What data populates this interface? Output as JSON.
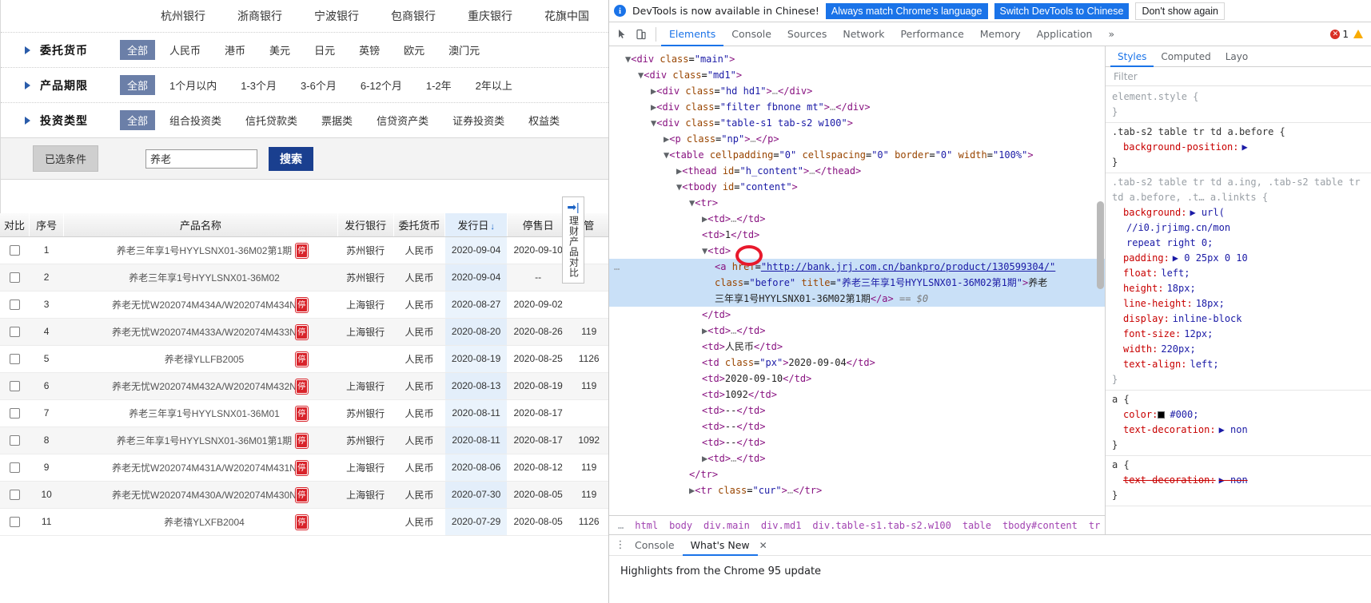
{
  "page": {
    "banks": [
      "杭州银行",
      "浙商银行",
      "宁波银行",
      "包商银行",
      "重庆银行",
      "花旗中国"
    ],
    "filters": [
      {
        "label": "委托货币",
        "all": "全部",
        "options": [
          "人民币",
          "港币",
          "美元",
          "日元",
          "英镑",
          "欧元",
          "澳门元"
        ]
      },
      {
        "label": "产品期限",
        "all": "全部",
        "options": [
          "1个月以内",
          "1-3个月",
          "3-6个月",
          "6-12个月",
          "1-2年",
          "2年以上"
        ]
      },
      {
        "label": "投资类型",
        "all": "全部",
        "options": [
          "组合投资类",
          "信托贷款类",
          "票据类",
          "信贷资产类",
          "证券投资类",
          "权益类"
        ]
      }
    ],
    "search": {
      "selected_conditions_label": "已选条件",
      "input_value": "养老",
      "input_placeholder": "",
      "button_label": "搜索"
    },
    "compare_panel": {
      "arrow": "➡|",
      "text": "理财产品对比"
    },
    "table": {
      "headers": [
        "对比",
        "序号",
        "产品名称",
        "发行银行",
        "委托货币",
        "发行日",
        "停售日",
        "管"
      ],
      "sorted_column": "发行日",
      "sort_arrow": "↓",
      "rows": [
        {
          "no": "1",
          "name": "养老三年享1号HYYLSNX01-36M02第1期",
          "stop": "停",
          "bank": "苏州银行",
          "cur": "人民币",
          "issue": "2020-09-04",
          "stopdate": "2020-09-10",
          "mg": ""
        },
        {
          "no": "2",
          "name": "养老三年享1号HYYLSNX01-36M02",
          "stop": "",
          "bank": "苏州银行",
          "cur": "人民币",
          "issue": "2020-09-04",
          "stopdate": "--",
          "mg": ""
        },
        {
          "no": "3",
          "name": "养老无忧W202074M434A/W202074M434N",
          "stop": "停",
          "bank": "上海银行",
          "cur": "人民币",
          "issue": "2020-08-27",
          "stopdate": "2020-09-02",
          "mg": ""
        },
        {
          "no": "4",
          "name": "养老无忧W202074M433A/W202074M433N",
          "stop": "停",
          "bank": "上海银行",
          "cur": "人民币",
          "issue": "2020-08-20",
          "stopdate": "2020-08-26",
          "mg": "119"
        },
        {
          "no": "5",
          "name": "养老禄YLLFB2005",
          "stop": "停",
          "bank": "",
          "cur": "人民币",
          "issue": "2020-08-19",
          "stopdate": "2020-08-25",
          "mg": "1126"
        },
        {
          "no": "6",
          "name": "养老无忧W202074M432A/W202074M432N",
          "stop": "停",
          "bank": "上海银行",
          "cur": "人民币",
          "issue": "2020-08-13",
          "stopdate": "2020-08-19",
          "mg": "119"
        },
        {
          "no": "7",
          "name": "养老三年享1号HYYLSNX01-36M01",
          "stop": "停",
          "bank": "苏州银行",
          "cur": "人民币",
          "issue": "2020-08-11",
          "stopdate": "2020-08-17",
          "mg": ""
        },
        {
          "no": "8",
          "name": "养老三年享1号HYYLSNX01-36M01第1期",
          "stop": "停",
          "bank": "苏州银行",
          "cur": "人民币",
          "issue": "2020-08-11",
          "stopdate": "2020-08-17",
          "mg": "1092"
        },
        {
          "no": "9",
          "name": "养老无忧W202074M431A/W202074M431N",
          "stop": "停",
          "bank": "上海银行",
          "cur": "人民币",
          "issue": "2020-08-06",
          "stopdate": "2020-08-12",
          "mg": "119"
        },
        {
          "no": "10",
          "name": "养老无忧W202074M430A/W202074M430N",
          "stop": "停",
          "bank": "上海银行",
          "cur": "人民币",
          "issue": "2020-07-30",
          "stopdate": "2020-08-05",
          "mg": "119"
        },
        {
          "no": "11",
          "name": "养老禧YLXFB2004",
          "stop": "停",
          "bank": "",
          "cur": "人民币",
          "issue": "2020-07-29",
          "stopdate": "2020-08-05",
          "mg": "1126"
        }
      ]
    }
  },
  "devtools": {
    "banner": {
      "message": "DevTools is now available in Chinese!",
      "btn_always": "Always match Chrome's language",
      "btn_switch": "Switch DevTools to Chinese",
      "btn_dismiss": "Don't show again"
    },
    "tabs": [
      "Elements",
      "Console",
      "Sources",
      "Network",
      "Performance",
      "Memory",
      "Application"
    ],
    "tabs_overflow": "»",
    "active_tab": "Elements",
    "error_count": "1",
    "dom_lines": [
      {
        "indent": 1,
        "html": "<span class=\"tk-arrow\">▼</span><span class=\"tk-tag\">&lt;div</span> <span class=\"tk-attr\">class</span>=<span class=\"tk-val\">\"main\"</span><span class=\"tk-tag\">&gt;</span>"
      },
      {
        "indent": 2,
        "html": "<span class=\"tk-arrow\">▼</span><span class=\"tk-tag\">&lt;div</span> <span class=\"tk-attr\">class</span>=<span class=\"tk-val\">\"md1\"</span><span class=\"tk-tag\">&gt;</span>"
      },
      {
        "indent": 3,
        "html": "<span class=\"tk-arrow\">▶</span><span class=\"tk-tag\">&lt;div</span> <span class=\"tk-attr\">class</span>=<span class=\"tk-val\">\"hd hd1\"</span><span class=\"tk-tag\">&gt;</span><span class=\"tk-dim\">…</span><span class=\"tk-tag\">&lt;/div&gt;</span>"
      },
      {
        "indent": 3,
        "html": "<span class=\"tk-arrow\">▶</span><span class=\"tk-tag\">&lt;div</span> <span class=\"tk-attr\">class</span>=<span class=\"tk-val\">\"filter fbnone mt\"</span><span class=\"tk-tag\">&gt;</span><span class=\"tk-dim\">…</span><span class=\"tk-tag\">&lt;/div&gt;</span>"
      },
      {
        "indent": 3,
        "html": "<span class=\"tk-arrow\">▼</span><span class=\"tk-tag\">&lt;div</span> <span class=\"tk-attr\">class</span>=<span class=\"tk-val\">\"table-s1 tab-s2 w100\"</span><span class=\"tk-tag\">&gt;</span>"
      },
      {
        "indent": 4,
        "html": "<span class=\"tk-arrow\">▶</span><span class=\"tk-tag\">&lt;p</span> <span class=\"tk-attr\">class</span>=<span class=\"tk-val\">\"np\"</span><span class=\"tk-tag\">&gt;</span><span class=\"tk-dim\">…</span><span class=\"tk-tag\">&lt;/p&gt;</span>"
      },
      {
        "indent": 4,
        "html": "<span class=\"tk-arrow\">▼</span><span class=\"tk-tag\">&lt;table</span> <span class=\"tk-attr\">cellpadding</span>=<span class=\"tk-val\">\"0\"</span> <span class=\"tk-attr\">cellspacing</span>=<span class=\"tk-val\">\"0\"</span> <span class=\"tk-attr\">border</span>=<span class=\"tk-val\">\"0\"</span> <span class=\"tk-attr\">width</span>=<span class=\"tk-val\">\"100%\"</span><span class=\"tk-tag\">&gt;</span>"
      },
      {
        "indent": 5,
        "html": "<span class=\"tk-arrow\">▶</span><span class=\"tk-tag\">&lt;thead</span> <span class=\"tk-attr\">id</span>=<span class=\"tk-val\">\"h_content\"</span><span class=\"tk-tag\">&gt;</span><span class=\"tk-dim\">…</span><span class=\"tk-tag\">&lt;/thead&gt;</span>"
      },
      {
        "indent": 5,
        "html": "<span class=\"tk-arrow\">▼</span><span class=\"tk-tag\">&lt;tbody</span> <span class=\"tk-attr\">id</span>=<span class=\"tk-val\">\"content\"</span><span class=\"tk-tag\">&gt;</span>"
      },
      {
        "indent": 6,
        "html": "<span class=\"tk-arrow\">▼</span><span class=\"tk-tag\">&lt;tr&gt;</span>"
      },
      {
        "indent": 7,
        "html": "<span class=\"tk-arrow\">▶</span><span class=\"tk-tag\">&lt;td&gt;</span><span class=\"tk-dim\">…</span><span class=\"tk-tag\">&lt;/td&gt;</span>"
      },
      {
        "indent": 7,
        "html": "<span class=\"tk-tag\">&lt;td&gt;</span><span class=\"tk-txt\">1</span><span class=\"tk-tag\">&lt;/td&gt;</span>",
        "nomark": true
      },
      {
        "indent": 7,
        "html": "<span class=\"tk-arrow\">▼</span><span class=\"tk-tag\">&lt;td&gt;</span>"
      },
      {
        "indent": 8,
        "selected": true,
        "dots": true,
        "html": "<span class=\"tk-tag\">&lt;a</span> <span class=\"tk-attr\">href</span>=<span class=\"tk-link\">\"http://bank.jrj.com.cn/bankpro/product/130599304/\"</span>"
      },
      {
        "indent": 8,
        "selected": true,
        "html": "<span class=\"tk-attr\">class</span>=<span class=\"tk-val\">\"before\"</span> <span class=\"tk-attr\">title</span>=<span class=\"tk-val\">\"养老三年享1号HYYLSNX01-36M02第1期\"</span><span class=\"tk-tag\">&gt;</span><span class=\"tk-txt\">养老</span>"
      },
      {
        "indent": 8,
        "selected": true,
        "html": "<span class=\"tk-txt\">三年享1号HYYLSNX01-36M02第1期</span><span class=\"tk-tag\">&lt;/a&gt;</span> <span class=\"tk-dollar\">== $0</span>"
      },
      {
        "indent": 7,
        "html": "<span class=\"tk-tag\">&lt;/td&gt;</span>"
      },
      {
        "indent": 7,
        "html": "<span class=\"tk-arrow\">▶</span><span class=\"tk-tag\">&lt;td&gt;</span><span class=\"tk-dim\">…</span><span class=\"tk-tag\">&lt;/td&gt;</span>"
      },
      {
        "indent": 7,
        "html": "<span class=\"tk-tag\">&lt;td&gt;</span><span class=\"tk-txt\">人民币</span><span class=\"tk-tag\">&lt;/td&gt;</span>"
      },
      {
        "indent": 7,
        "html": "<span class=\"tk-tag\">&lt;td</span> <span class=\"tk-attr\">class</span>=<span class=\"tk-val\">\"px\"</span><span class=\"tk-tag\">&gt;</span><span class=\"tk-txt\">2020-09-04</span><span class=\"tk-tag\">&lt;/td&gt;</span>"
      },
      {
        "indent": 7,
        "html": "<span class=\"tk-tag\">&lt;td&gt;</span><span class=\"tk-txt\">2020-09-10</span><span class=\"tk-tag\">&lt;/td&gt;</span>"
      },
      {
        "indent": 7,
        "html": "<span class=\"tk-tag\">&lt;td&gt;</span><span class=\"tk-txt\">1092</span><span class=\"tk-tag\">&lt;/td&gt;</span>"
      },
      {
        "indent": 7,
        "html": "<span class=\"tk-tag\">&lt;td&gt;</span><span class=\"tk-txt\">--</span><span class=\"tk-tag\">&lt;/td&gt;</span>"
      },
      {
        "indent": 7,
        "html": "<span class=\"tk-tag\">&lt;td&gt;</span><span class=\"tk-txt\">--</span><span class=\"tk-tag\">&lt;/td&gt;</span>"
      },
      {
        "indent": 7,
        "html": "<span class=\"tk-tag\">&lt;td&gt;</span><span class=\"tk-txt\">--</span><span class=\"tk-tag\">&lt;/td&gt;</span>"
      },
      {
        "indent": 7,
        "html": "<span class=\"tk-arrow\">▶</span><span class=\"tk-tag\">&lt;td&gt;</span><span class=\"tk-dim\">…</span><span class=\"tk-tag\">&lt;/td&gt;</span>"
      },
      {
        "indent": 6,
        "html": "<span class=\"tk-tag\">&lt;/tr&gt;</span>"
      },
      {
        "indent": 6,
        "html": "<span class=\"tk-arrow\">▶</span><span class=\"tk-tag\">&lt;tr</span> <span class=\"tk-attr\">class</span>=<span class=\"tk-val\">\"cur\"</span><span class=\"tk-tag\">&gt;</span><span class=\"tk-dim\">…</span><span class=\"tk-tag\">&lt;/tr&gt;</span>"
      }
    ],
    "breadcrumb": [
      "…",
      "html",
      "body",
      "div.main",
      "div.md1",
      "div.table-s1.tab-s2.w100",
      "table",
      "tbody#content",
      "tr",
      "…"
    ],
    "styles": {
      "tabs": [
        "Styles",
        "Computed",
        "Layo"
      ],
      "active_tab": "Styles",
      "filter_placeholder": "Filter",
      "rules": [
        {
          "selector": "element.style {",
          "gray": true,
          "props": [],
          "close": "}"
        },
        {
          "selector": ".tab-s2 table tr td a.before {",
          "gray": false,
          "props": [
            {
              "name": "background-position:",
              "value": "▶"
            }
          ],
          "close": "}"
        },
        {
          "selector": ".tab-s2 table tr td a.ing, .tab-s2 table tr td a.before, .t… a.linkts {",
          "gray": true,
          "props": [
            {
              "name": "background:",
              "value": "▶ url("
            },
            {
              "name": "",
              "value": "//i0.jrjimg.cn/mon"
            },
            {
              "name": "",
              "value": "repeat right 0;"
            },
            {
              "name": "padding:",
              "value": "▶ 0 25px 0 10"
            },
            {
              "name": "float:",
              "value": "left;"
            },
            {
              "name": "height:",
              "value": "18px;"
            },
            {
              "name": "line-height:",
              "value": "18px;"
            },
            {
              "name": "display:",
              "value": "inline-block"
            },
            {
              "name": "font-size:",
              "value": "12px;"
            },
            {
              "name": "width:",
              "value": "220px;"
            },
            {
              "name": "text-align:",
              "value": "left;"
            }
          ],
          "close": "}"
        },
        {
          "selector": "a {",
          "gray": false,
          "props": [
            {
              "name": "color:",
              "value": "#000;",
              "swatch": true
            },
            {
              "name": "text-decoration:",
              "value": "▶ non"
            }
          ],
          "close": "}"
        },
        {
          "selector": "a {",
          "gray": false,
          "props": [
            {
              "name": "text-decoration:",
              "value": "▶ non",
              "strike": true
            }
          ],
          "close": "}"
        }
      ]
    },
    "drawer": {
      "tabs": [
        "Console",
        "What's New"
      ],
      "active_tab": "What's New",
      "close_label": "✕",
      "content": "Highlights from the Chrome 95 update"
    }
  }
}
